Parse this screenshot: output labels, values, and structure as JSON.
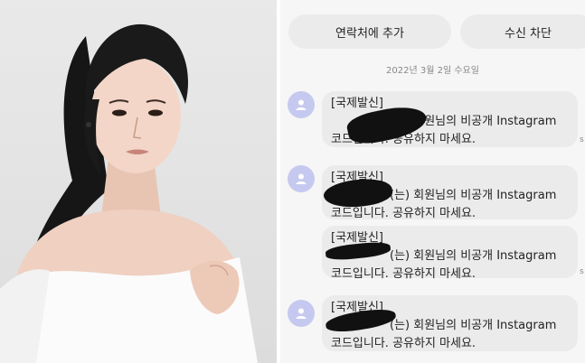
{
  "photo": {
    "alt_subject": "woman in white off-shoulder top"
  },
  "phone": {
    "buttons": {
      "add_contact": "연락처에 추가",
      "block": "수신 차단"
    },
    "date": "2022년 3월 2일 수요일",
    "messages": [
      {
        "tag": "[국제발신]",
        "line1": "(는) 회원님의 비공개 Instagram",
        "line2": "코드입니다. 공유하지 마세요."
      },
      {
        "tag": "[국제발신]",
        "line1": "(는) 회원님의 비공개 Instagram",
        "line2": "코드입니다. 공유하지 마세요."
      },
      {
        "tag": "[국제발신]",
        "line1": "(는) 회원님의 비공개 Instagram",
        "line2": "코드입니다. 공유하지 마세요."
      },
      {
        "tag": "[국제발신]",
        "line1": "(는) 회원님의 비공개 Instagram",
        "line2": "코드입니다. 공유하지 마세요."
      }
    ],
    "time_fragment": "s"
  }
}
